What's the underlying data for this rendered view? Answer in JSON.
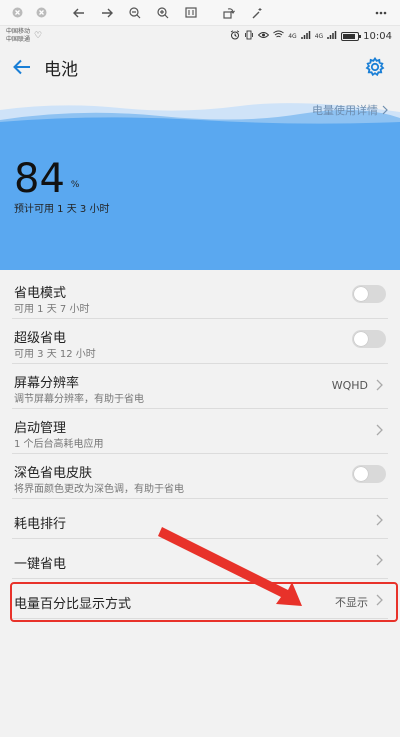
{
  "header": {
    "title": "电池"
  },
  "status_bar": {
    "carrier_1": "中国移动",
    "carrier_2": "中国联通",
    "time": "10:04",
    "network_1": "4G",
    "network_2": "4G"
  },
  "battery_panel": {
    "usage_link": "电量使用详情",
    "percent": "84",
    "percent_sign": "%",
    "estimate": "预计可用 1 天 3 小时",
    "level": 84
  },
  "rows": [
    {
      "title": "省电模式",
      "sub": "可用 1 天 7 小时"
    },
    {
      "title": "超级省电",
      "sub": "可用 3 天 12 小时"
    },
    {
      "title": "屏幕分辨率",
      "sub": "调节屏幕分辨率，有助于省电",
      "value": "WQHD"
    },
    {
      "title": "启动管理",
      "sub": "1 个后台高耗电应用"
    },
    {
      "title": "深色省电皮肤",
      "sub": "将界面颜色更改为深色调，有助于省电"
    },
    {
      "title": "耗电排行"
    },
    {
      "title": "一键省电"
    },
    {
      "title": "电量百分比显示方式",
      "value": "不显示"
    }
  ],
  "colors": {
    "accent": "#1a7fd6",
    "panel": "#5aa8f0",
    "highlight": "#e8322a"
  }
}
